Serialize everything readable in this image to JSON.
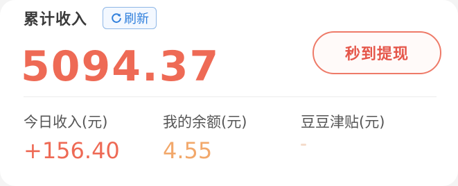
{
  "header": {
    "title": "累计收入",
    "refresh_label": "刷新"
  },
  "total_income": "5094.37",
  "withdraw_button_label": "秒到提现",
  "stats": {
    "today": {
      "label": "今日收入(元)",
      "value": "+156.40"
    },
    "balance": {
      "label": "我的余额(元)",
      "value": "4.55"
    },
    "subsidy": {
      "label": "豆豆津贴(元)",
      "value": ""
    }
  },
  "colors": {
    "accent_red": "#ee6a55",
    "accent_orange": "#f2a86b",
    "refresh_blue": "#2f7fdc"
  },
  "icons": {
    "refresh": "refresh-icon"
  }
}
